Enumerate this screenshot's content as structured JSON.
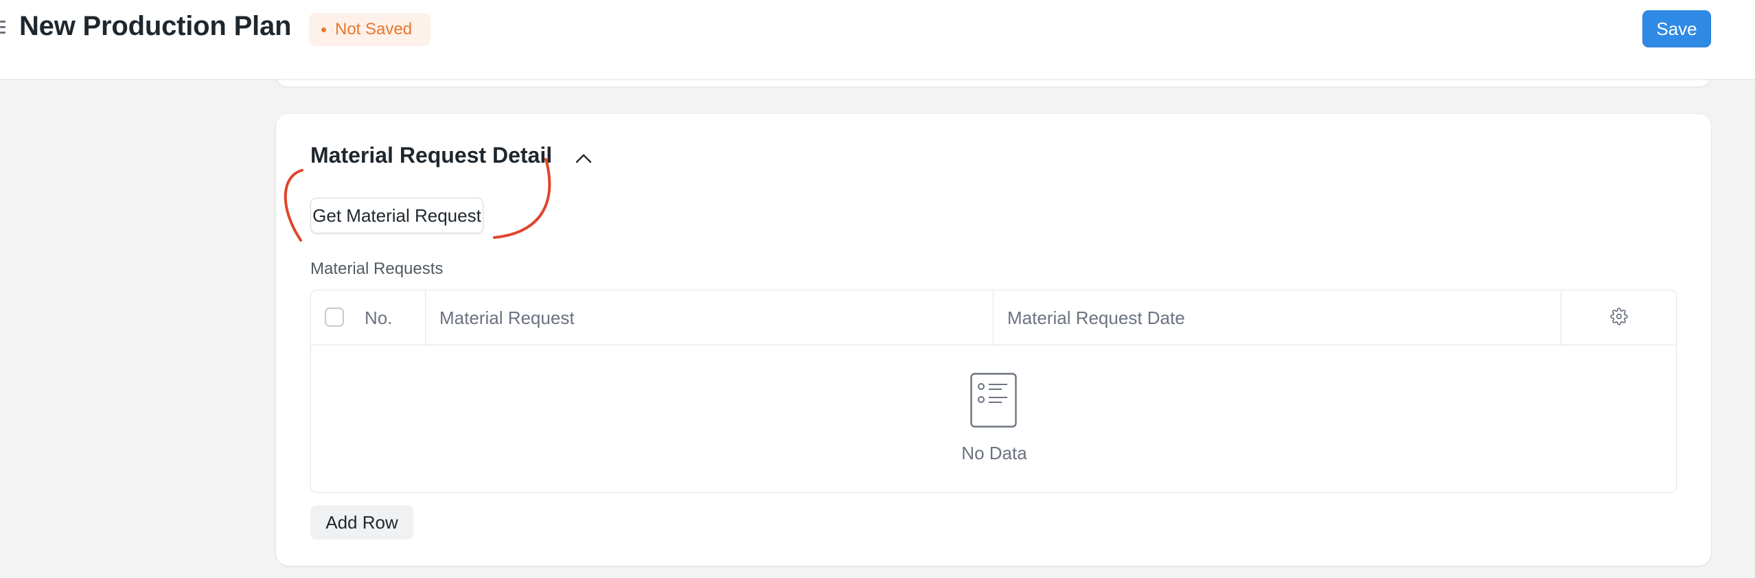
{
  "header": {
    "title": "New Production Plan",
    "status": "Not Saved",
    "save_label": "Save"
  },
  "section": {
    "title": "Material Request Detail",
    "get_button_label": "Get Material Request",
    "field_label": "Material Requests",
    "grid": {
      "columns": [
        "No.",
        "Material Request",
        "Material Request Date"
      ],
      "rows": [],
      "empty_text": "No Data"
    },
    "add_row_label": "Add Row"
  },
  "icons": {
    "menu": "hamburger-icon",
    "collapse": "chevron-up-icon",
    "settings": "gear-icon",
    "empty": "document-list-icon"
  },
  "colors": {
    "primary": "#2f8ae6",
    "status": "#e8772e",
    "status_bg": "#fdf1ea",
    "annotation": "#e0452b"
  }
}
